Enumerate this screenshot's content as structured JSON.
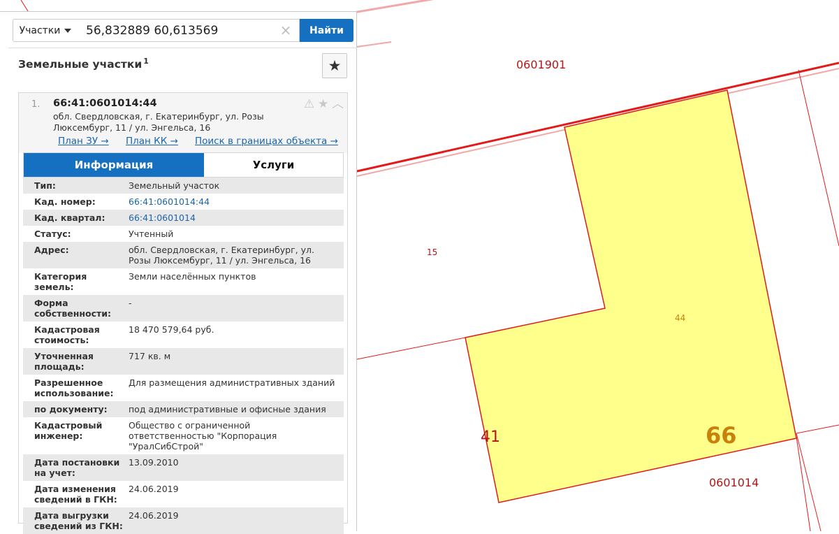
{
  "search": {
    "type_label": "Участки",
    "query": "56,832889 60,613569",
    "clear_icon": "close-icon",
    "find_label": "Найти"
  },
  "panel": {
    "title": "Земельные участки",
    "count": "1",
    "favorite_icon": "star-icon"
  },
  "result": {
    "number": "1.",
    "cad_number": "66:41:0601014:44",
    "address": "обл. Свердловская, г. Екатеринбург, ул. Розы Люксембург, 11 / ул. Энгельса, 16",
    "links": [
      "План ЗУ →",
      "План КК →",
      "Поиск в границах объекта →"
    ],
    "tabs": {
      "info": "Информация",
      "services": "Услуги"
    }
  },
  "attributes": [
    {
      "key": "Тип:",
      "value": "Земельный участок"
    },
    {
      "key": "Кад. номер:",
      "value": "66:41:0601014:44",
      "link": true
    },
    {
      "key": "Кад. квартал:",
      "value": "66:41:0601014",
      "link": true
    },
    {
      "key": "Статус:",
      "value": "Учтенный"
    },
    {
      "key": "Адрес:",
      "value": "обл. Свердловская, г. Екатеринбург, ул. Розы Люксембург, 11 / ул. Энгельса, 16"
    },
    {
      "key": "Категория земель:",
      "value": "Земли населённых пунктов"
    },
    {
      "key": "Форма собственности:",
      "value": "-"
    },
    {
      "key": "Кадастровая стоимость:",
      "value": "18 470 579,64 руб."
    },
    {
      "key": "Уточненная площадь:",
      "value": "717 кв. м"
    },
    {
      "key": "Разрешенное использование:",
      "value": "Для размещения административных зданий"
    },
    {
      "key": "по документу:",
      "value": "под административные и офисные здания"
    },
    {
      "key": "Кадастровый инженер:",
      "value": "Общество с ограниченной ответственностью \"Корпорация \"УралСибСтрой\""
    },
    {
      "key": "Дата постановки на учет:",
      "value": "13.09.2010"
    },
    {
      "key": "Дата изменения сведений в ГКН:",
      "value": "24.06.2019"
    },
    {
      "key": "Дата выгрузки сведений из ГКН:",
      "value": "24.06.2019"
    }
  ],
  "map": {
    "labels": {
      "block_north": "0601901",
      "block_south": "0601014",
      "parcel_15": "15",
      "parcel_44": "44",
      "district_41": "41",
      "region_66": "66"
    },
    "colors": {
      "parcel_fill": "#ffff8c",
      "boundary": "#e31a1a",
      "label": "#b01818",
      "region_label": "#c8820a"
    }
  }
}
